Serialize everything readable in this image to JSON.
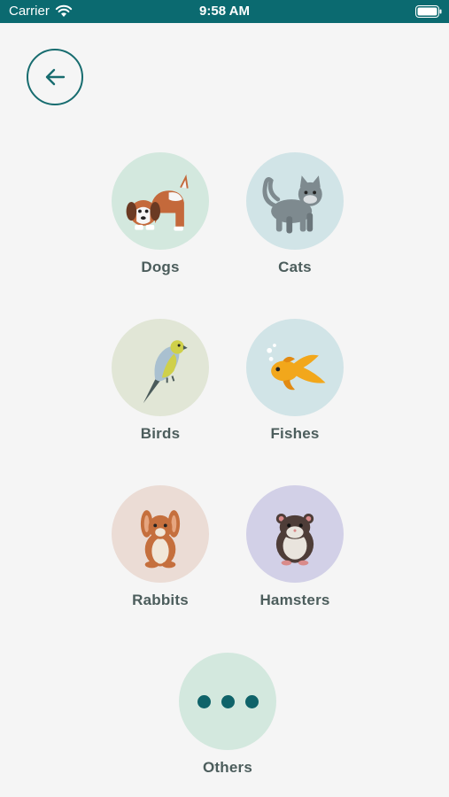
{
  "status_bar": {
    "carrier": "Carrier",
    "time": "9:58 AM"
  },
  "back_button_icon": "arrow-left-icon",
  "categories": [
    {
      "label": "Dogs",
      "icon": "dog-icon",
      "color": "#d3e8de"
    },
    {
      "label": "Cats",
      "icon": "cat-icon",
      "color": "#d1e4e7"
    },
    {
      "label": "Birds",
      "icon": "bird-icon",
      "color": "#e1e6d6"
    },
    {
      "label": "Fishes",
      "icon": "fish-icon",
      "color": "#d1e4e7"
    },
    {
      "label": "Rabbits",
      "icon": "rabbit-icon",
      "color": "#ebdcd5"
    },
    {
      "label": "Hamsters",
      "icon": "hamster-icon",
      "color": "#d2d0e7"
    },
    {
      "label": "Others",
      "icon": "more-dots-icon",
      "color": "#d3e8de"
    }
  ]
}
